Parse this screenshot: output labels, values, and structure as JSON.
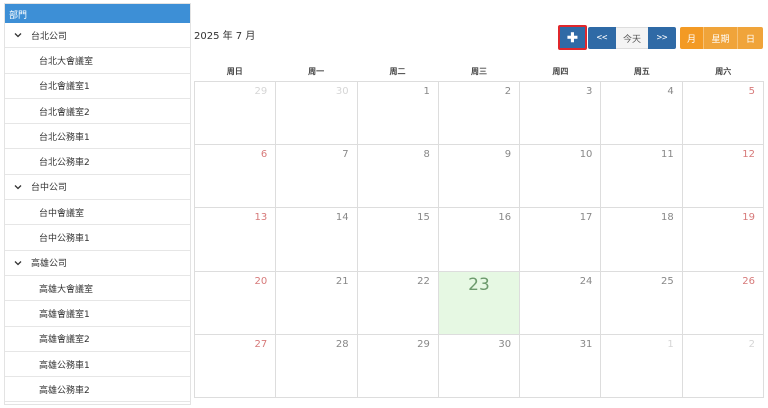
{
  "sidebar": {
    "header": "部門",
    "items": [
      {
        "type": "group",
        "label": "台北公司"
      },
      {
        "type": "leaf",
        "label": "台北大會議室"
      },
      {
        "type": "leaf",
        "label": "台北會議室1"
      },
      {
        "type": "leaf",
        "label": "台北會議室2"
      },
      {
        "type": "leaf",
        "label": "台北公務車1"
      },
      {
        "type": "leaf",
        "label": "台北公務車2"
      },
      {
        "type": "group",
        "label": "台中公司"
      },
      {
        "type": "leaf",
        "label": "台中會議室"
      },
      {
        "type": "leaf",
        "label": "台中公務車1"
      },
      {
        "type": "group",
        "label": "高雄公司"
      },
      {
        "type": "leaf",
        "label": "高雄大會議室"
      },
      {
        "type": "leaf",
        "label": "高雄會議室1"
      },
      {
        "type": "leaf",
        "label": "高雄會議室2"
      },
      {
        "type": "leaf",
        "label": "高雄公務車1"
      },
      {
        "type": "leaf",
        "label": "高雄公務車2"
      }
    ]
  },
  "calendar": {
    "title": "2025 年 7 月",
    "weekdays": [
      "周日",
      "周一",
      "周二",
      "周三",
      "周四",
      "周五",
      "周六"
    ],
    "days": [
      {
        "n": "29",
        "other": true
      },
      {
        "n": "30",
        "other": true
      },
      {
        "n": "1"
      },
      {
        "n": "2"
      },
      {
        "n": "3"
      },
      {
        "n": "4"
      },
      {
        "n": "5"
      },
      {
        "n": "6"
      },
      {
        "n": "7"
      },
      {
        "n": "8"
      },
      {
        "n": "9"
      },
      {
        "n": "10"
      },
      {
        "n": "11"
      },
      {
        "n": "12"
      },
      {
        "n": "13"
      },
      {
        "n": "14"
      },
      {
        "n": "15"
      },
      {
        "n": "16"
      },
      {
        "n": "17"
      },
      {
        "n": "18"
      },
      {
        "n": "19"
      },
      {
        "n": "20"
      },
      {
        "n": "21"
      },
      {
        "n": "22"
      },
      {
        "n": "23",
        "today": true
      },
      {
        "n": "24"
      },
      {
        "n": "25"
      },
      {
        "n": "26"
      },
      {
        "n": "27"
      },
      {
        "n": "28"
      },
      {
        "n": "29"
      },
      {
        "n": "30"
      },
      {
        "n": "31"
      },
      {
        "n": "1",
        "other": true
      },
      {
        "n": "2",
        "other": true
      }
    ]
  },
  "toolbar": {
    "add_label": "✚",
    "prev_label": "<<",
    "today_label": "今天",
    "next_label": ">>",
    "month_label": "月",
    "week_label": "星期",
    "day_label": "日"
  },
  "colors": {
    "sidebar_header": "#3d8fd6",
    "nav_button": "#2f6aa6",
    "view_button": "#f0a43a",
    "today_highlight": "#e6f8e3",
    "weekend_text": "#d77a7a"
  }
}
